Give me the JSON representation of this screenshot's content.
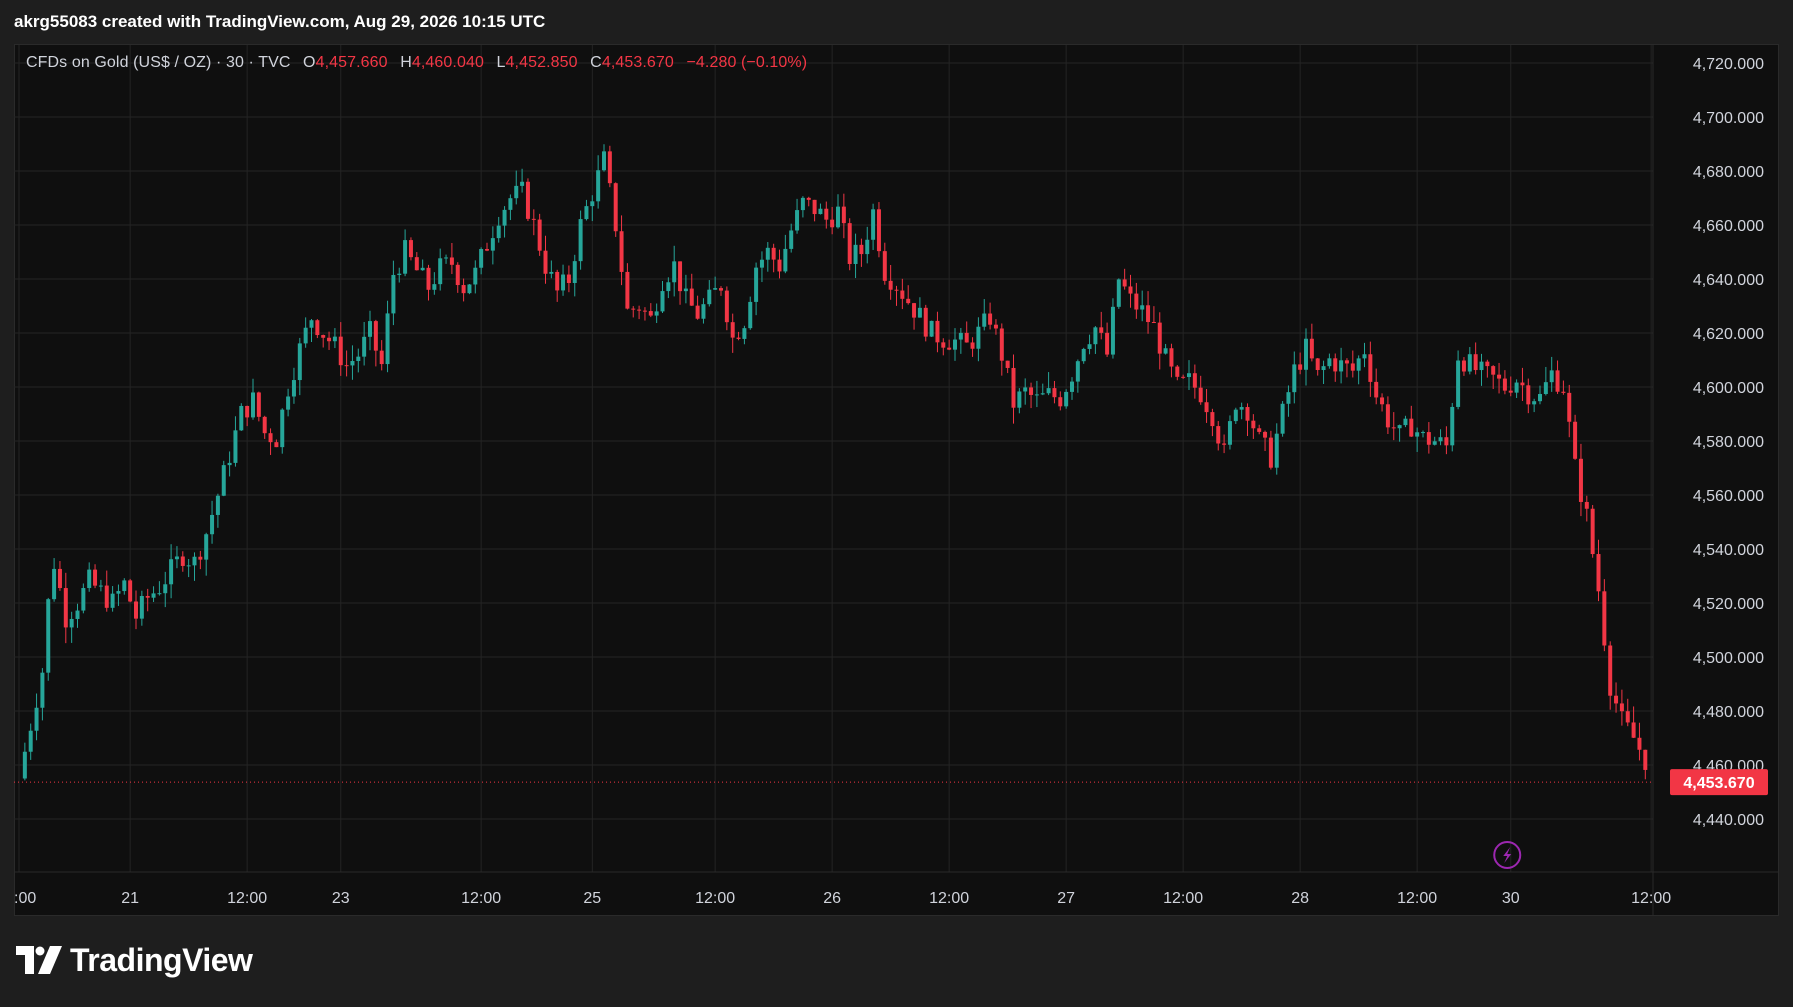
{
  "header": {
    "credit": "akrg55083 created with TradingView.com, Aug 29, 2026 10:15 UTC"
  },
  "legend": {
    "symbol": "CFDs on Gold (US$ / OZ) · 30 · TVC",
    "open_label": "O",
    "open": "4,457.660",
    "high_label": "H",
    "high": "4,460.040",
    "low_label": "L",
    "low": "4,452.850",
    "close_label": "C",
    "close": "4,453.670",
    "change": "−4.280 (−0.10%)"
  },
  "logo": {
    "text": "TradingView",
    "icon": "tradingview-logo-icon"
  },
  "colors": {
    "up": "#26a69a",
    "down": "#f23645",
    "grid": "#242424",
    "axis_text": "#d1d4dc",
    "price_tag_bg": "#f23645",
    "lightning": "#9c27b0"
  },
  "chart_data": {
    "type": "candlestick",
    "title": "CFDs on Gold (US$ / OZ) · 30 · TVC",
    "ylim": [
      4420,
      4725
    ],
    "y_ticks": [
      4440,
      4460,
      4480,
      4500,
      4520,
      4540,
      4560,
      4580,
      4600,
      4620,
      4640,
      4660,
      4680,
      4700,
      4720
    ],
    "y_tick_labels": [
      "4,440.000",
      "4,460.000",
      "4,480.000",
      "4,500.000",
      "4,520.000",
      "4,540.000",
      "4,560.000",
      "4,580.000",
      "4,600.000",
      "4,620.000",
      "4,640.000",
      "4,660.000",
      "4,680.000",
      "4,700.000",
      "4,720.000"
    ],
    "x_ticks": [
      {
        "label": ":00",
        "t": 0
      },
      {
        "label": "21",
        "t": 9.5
      },
      {
        "label": "12:00",
        "t": 19.5
      },
      {
        "label": "23",
        "t": 27.5
      },
      {
        "label": "12:00",
        "t": 39.5
      },
      {
        "label": "25",
        "t": 49
      },
      {
        "label": "12:00",
        "t": 59.5
      },
      {
        "label": "26",
        "t": 69.5
      },
      {
        "label": "12:00",
        "t": 79.5
      },
      {
        "label": "27",
        "t": 89.5
      },
      {
        "label": "12:00",
        "t": 99.5
      },
      {
        "label": "28",
        "t": 109.5
      },
      {
        "label": "12:00",
        "t": 119.5
      },
      {
        "label": "30",
        "t": 127.5
      },
      {
        "label": "12:00",
        "t": 139.5
      }
    ],
    "xlim": [
      0,
      142
    ],
    "last_price": 4453.67,
    "last_price_label": "4,453.670",
    "path": [
      [
        0,
        4455
      ],
      [
        1,
        4475
      ],
      [
        2,
        4495
      ],
      [
        2.5,
        4520
      ],
      [
        3,
        4535
      ],
      [
        4,
        4515
      ],
      [
        5,
        4520
      ],
      [
        6,
        4528
      ],
      [
        7,
        4524
      ],
      [
        8,
        4520
      ],
      [
        9,
        4527
      ],
      [
        10,
        4515
      ],
      [
        11,
        4522
      ],
      [
        12,
        4526
      ],
      [
        13,
        4532
      ],
      [
        14,
        4538
      ],
      [
        15,
        4535
      ],
      [
        16,
        4546
      ],
      [
        17,
        4560
      ],
      [
        18,
        4575
      ],
      [
        19,
        4590
      ],
      [
        20,
        4595
      ],
      [
        21,
        4583
      ],
      [
        22,
        4581
      ],
      [
        23,
        4600
      ],
      [
        24,
        4614
      ],
      [
        25,
        4626
      ],
      [
        26,
        4620
      ],
      [
        27,
        4615
      ],
      [
        28,
        4608
      ],
      [
        29,
        4612
      ],
      [
        30,
        4620
      ],
      [
        31,
        4608
      ],
      [
        32,
        4642
      ],
      [
        33,
        4650
      ],
      [
        34,
        4643
      ],
      [
        35,
        4637
      ],
      [
        36,
        4644
      ],
      [
        37,
        4646
      ],
      [
        38,
        4637
      ],
      [
        39,
        4642
      ],
      [
        40,
        4653
      ],
      [
        41,
        4664
      ],
      [
        42,
        4670
      ],
      [
        43,
        4672
      ],
      [
        44,
        4660
      ],
      [
        45,
        4645
      ],
      [
        46,
        4635
      ],
      [
        47,
        4640
      ],
      [
        48,
        4660
      ],
      [
        49,
        4672
      ],
      [
        50,
        4684
      ],
      [
        51,
        4660
      ],
      [
        52,
        4628
      ],
      [
        53,
        4630
      ],
      [
        54,
        4625
      ],
      [
        55,
        4640
      ],
      [
        56,
        4645
      ],
      [
        57,
        4632
      ],
      [
        58,
        4627
      ],
      [
        59,
        4632
      ],
      [
        60,
        4638
      ],
      [
        61,
        4618
      ],
      [
        62,
        4625
      ],
      [
        63,
        4645
      ],
      [
        64,
        4650
      ],
      [
        65,
        4645
      ],
      [
        66,
        4658
      ],
      [
        67,
        4668
      ],
      [
        68,
        4666
      ],
      [
        69,
        4662
      ],
      [
        70,
        4665
      ],
      [
        71,
        4648
      ],
      [
        72,
        4650
      ],
      [
        73,
        4665
      ],
      [
        74,
        4643
      ],
      [
        75,
        4638
      ],
      [
        76,
        4632
      ],
      [
        77,
        4626
      ],
      [
        78,
        4620
      ],
      [
        79,
        4618
      ],
      [
        80,
        4617
      ],
      [
        81,
        4615
      ],
      [
        82,
        4620
      ],
      [
        83,
        4626
      ],
      [
        84,
        4612
      ],
      [
        85,
        4594
      ],
      [
        86,
        4598
      ],
      [
        87,
        4595
      ],
      [
        88,
        4597
      ],
      [
        89,
        4596
      ],
      [
        90,
        4605
      ],
      [
        91,
        4617
      ],
      [
        92,
        4622
      ],
      [
        93,
        4612
      ],
      [
        94,
        4640
      ],
      [
        95,
        4632
      ],
      [
        96,
        4628
      ],
      [
        97,
        4622
      ],
      [
        98,
        4610
      ],
      [
        99,
        4600
      ],
      [
        100,
        4602
      ],
      [
        101,
        4598
      ],
      [
        102,
        4590
      ],
      [
        103,
        4575
      ],
      [
        104,
        4595
      ],
      [
        105,
        4592
      ],
      [
        106,
        4580
      ],
      [
        107,
        4574
      ],
      [
        108,
        4590
      ],
      [
        109,
        4606
      ],
      [
        110,
        4614
      ],
      [
        111,
        4604
      ],
      [
        112,
        4610
      ],
      [
        113,
        4608
      ],
      [
        114,
        4606
      ],
      [
        115,
        4614
      ],
      [
        116,
        4597
      ],
      [
        117,
        4588
      ],
      [
        118,
        4582
      ],
      [
        119,
        4586
      ],
      [
        120,
        4581
      ],
      [
        121,
        4580
      ],
      [
        122,
        4578
      ],
      [
        123,
        4612
      ],
      [
        124,
        4608
      ],
      [
        125,
        4605
      ],
      [
        126,
        4603
      ],
      [
        127,
        4600
      ],
      [
        128,
        4603
      ],
      [
        129,
        4598
      ],
      [
        130,
        4596
      ],
      [
        131,
        4605
      ],
      [
        132,
        4600
      ],
      [
        133,
        4570
      ],
      [
        134,
        4552
      ],
      [
        135,
        4525
      ],
      [
        136,
        4490
      ],
      [
        137,
        4476
      ],
      [
        138,
        4470
      ],
      [
        139,
        4462
      ],
      [
        140,
        4458
      ],
      [
        141,
        4460
      ],
      [
        142,
        4453.67
      ]
    ]
  }
}
